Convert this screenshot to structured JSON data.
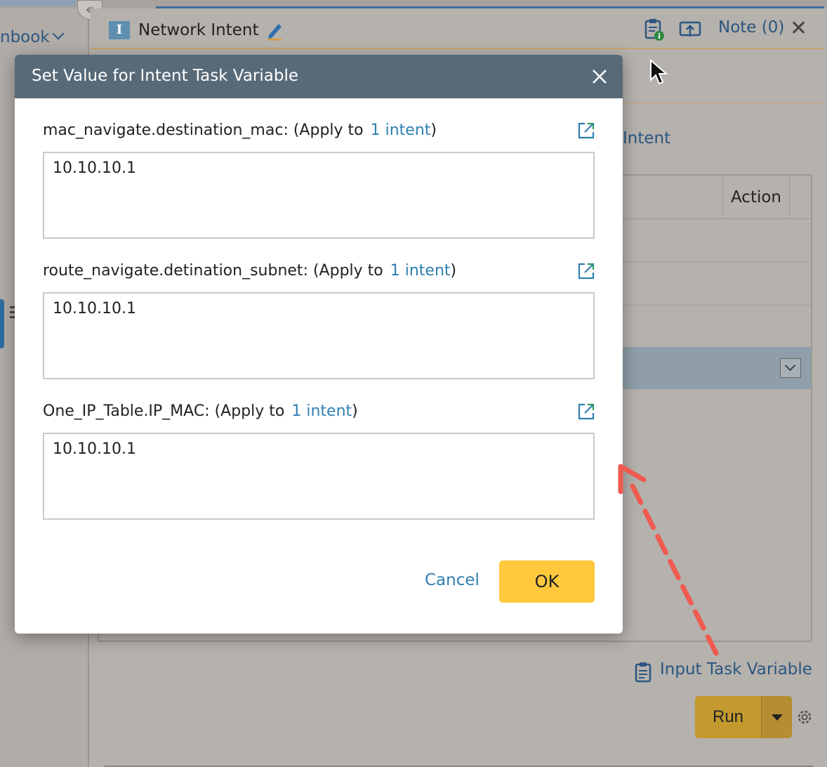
{
  "background": {
    "runbook_label": "nbook",
    "header_title": "Network Intent",
    "note_label": "Note (0)",
    "intent_link": "Intent",
    "table_action_header": "Action",
    "input_task_variable": "Input Task Variable",
    "run_label": "Run"
  },
  "dialog": {
    "title": "Set Value for Intent Task Variable",
    "fields": [
      {
        "name": "mac_navigate.destination_mac: (Apply to",
        "link": "1 intent",
        "suffix": ")",
        "value": "10.10.10.1"
      },
      {
        "name": "route_navigate.detination_subnet: (Apply to",
        "link": "1 intent",
        "suffix": ")",
        "value": "10.10.10.1"
      },
      {
        "name": "One_IP_Table.IP_MAC: (Apply to",
        "link": "1 intent",
        "suffix": ")",
        "value": "10.10.10.1"
      }
    ],
    "cancel_label": "Cancel",
    "ok_label": "OK"
  },
  "colors": {
    "dialog_header": "#586a78",
    "link": "#2f7fb0",
    "ok_button": "#ffc83d",
    "annotation_arrow": "#f05a4f"
  }
}
